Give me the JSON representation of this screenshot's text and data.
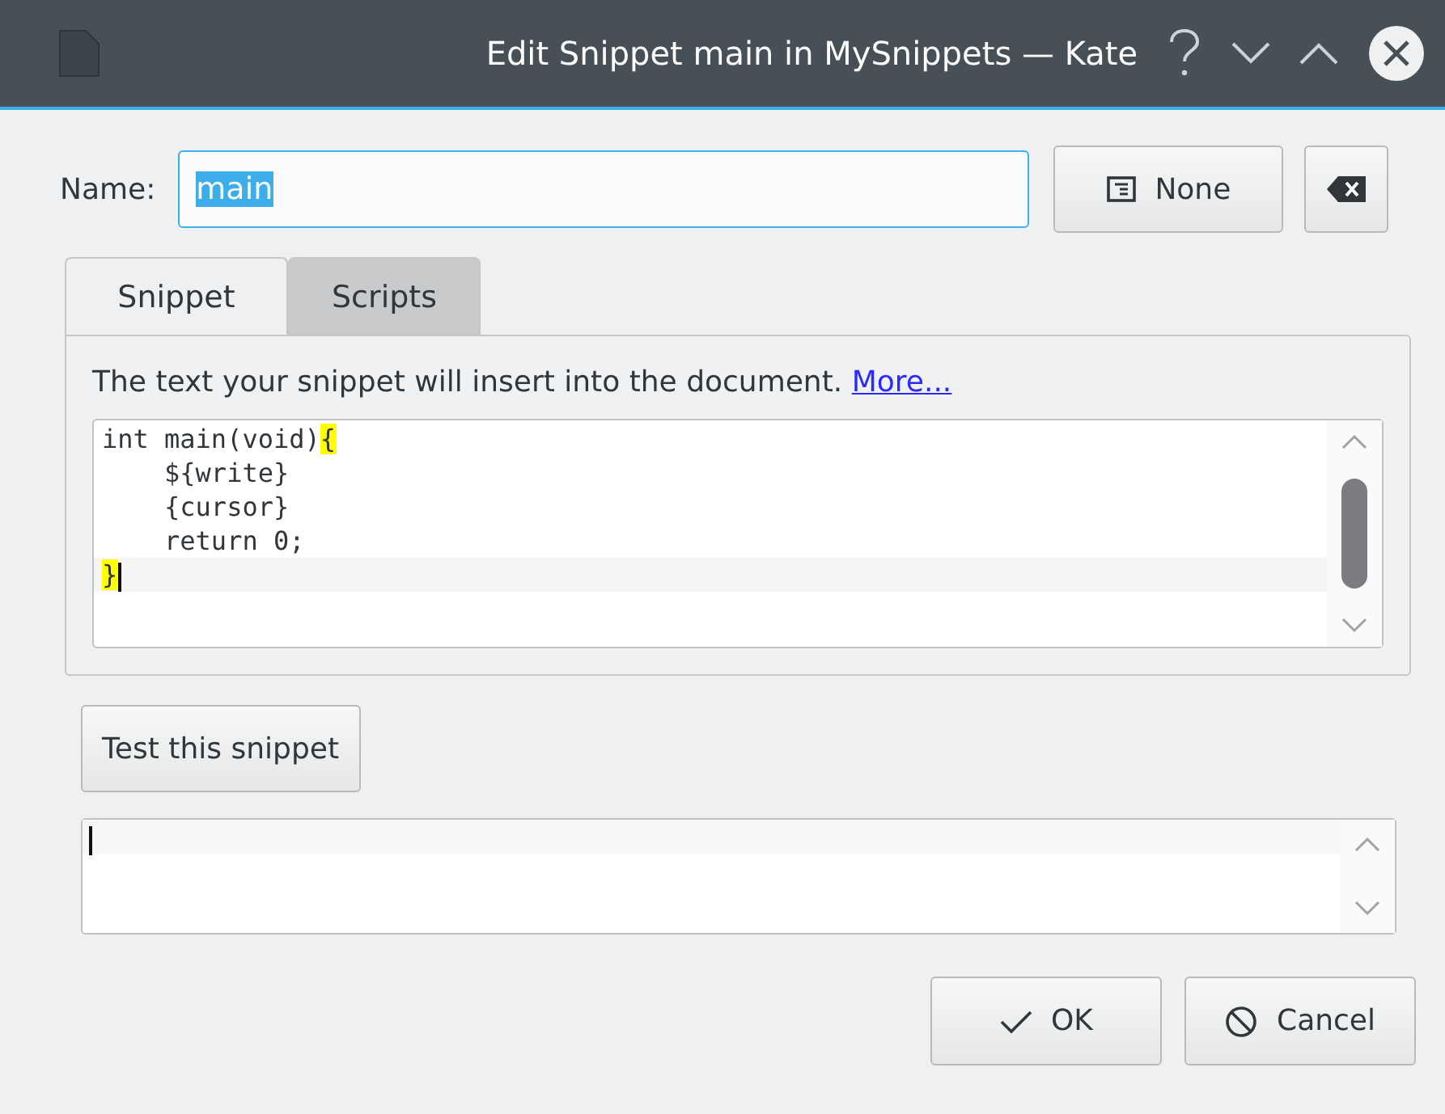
{
  "window": {
    "title": "Edit Snippet main in MySnippets — Kate"
  },
  "name_field": {
    "label": "Name:",
    "value": "main",
    "text_selected": true
  },
  "shortcut_button": {
    "label": "None"
  },
  "tabs": [
    {
      "label": "Snippet",
      "selected": true
    },
    {
      "label": "Scripts",
      "selected": false
    }
  ],
  "snippet_panel": {
    "description": "The text your snippet will insert into the document.",
    "link": "More...",
    "code_lines": [
      {
        "text": "int main(void)",
        "bracket": "{",
        "current": false
      },
      {
        "text": "    ${write}",
        "current": false
      },
      {
        "text": "    {cursor}",
        "current": false
      },
      {
        "text": "    return 0;",
        "current": false
      },
      {
        "bracket": "}",
        "current": true
      }
    ]
  },
  "test_button": {
    "label": "Test this snippet"
  },
  "buttons": [
    {
      "kind": "ok",
      "label": "OK"
    },
    {
      "kind": "cancel",
      "label": "Cancel"
    }
  ]
}
